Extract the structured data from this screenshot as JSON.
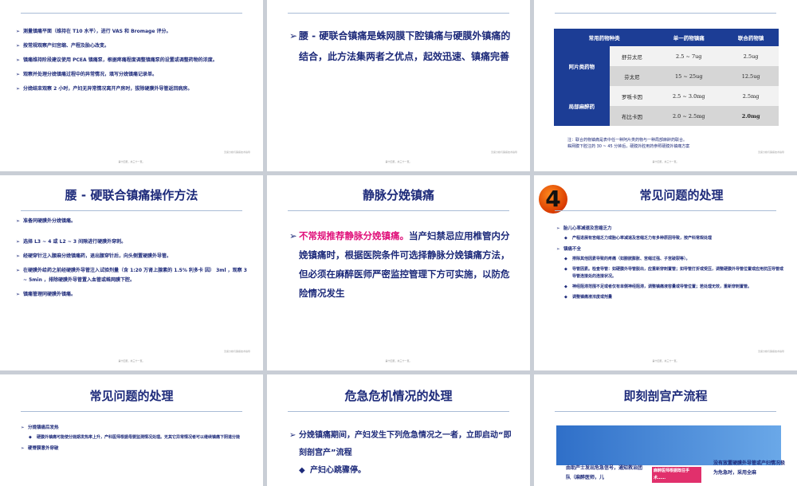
{
  "footer_text": "第十四页，共三十一页。",
  "footer_right": "无痛分娩与镇痛技术指导",
  "slide1": {
    "bullets": [
      "测量镇痛平面（维持在 T10 水平），进行 VAS 和 Bromage 评分。",
      "按常规观察产妇宫缩、产程及胎心改变。",
      "镇痛维持阶段建议使用 PCEA 镇痛泵，根据疼痛程度调整镇痛泵的设置或调整药物的浓度。",
      "观察并处理分娩镇痛过程中的异常情况，填写分娩镇痛记录单。",
      "分娩结束观察 2 小时，产妇无异常情况离开产房时，拔除硬膜外导管返回病房。"
    ]
  },
  "slide2": {
    "text": "腰 - 硬联合镇痛是蛛网膜下腔镇痛与硬膜外镇痛的结合，此方法集两者之优点，起效迅速、镇痛完善"
  },
  "slide3": {
    "headers": [
      "常用药物种类",
      "单一药物镇痛",
      "联合药物镇"
    ],
    "groups": [
      "阿片类药物",
      "局部麻醉药"
    ],
    "rows": [
      {
        "drug": "舒芬太尼",
        "single": "2.5 ~ 7ug",
        "combo": "2.5ug"
      },
      {
        "drug": "芬太尼",
        "single": "15 ~ 25ug",
        "combo": "12.5ug"
      },
      {
        "drug": "罗哌卡因",
        "single": "2.5 ~ 3.0mg",
        "combo": "2.5mg"
      },
      {
        "drug": "布比卡因",
        "single": "2.0 ~ 2.5mg",
        "combo": "2.0mg"
      }
    ],
    "note_lines": [
      "注：联合药物镇痛是表中任一种阿片类药物与一种局部麻醉药联合。",
      "蛛网膜下腔注药 30 ~ 45 分钟后，硬膜外腔用药参照硬膜外镇痛方案"
    ]
  },
  "slide4": {
    "title": "腰 - 硬联合镇痛操作方法",
    "bullets": [
      "准备同硬膜外分娩镇痛。",
      "选择 L3 ~ 4 或 L2 ~ 3 间隙进行硬膜外穿刺。",
      "经硬穿针注入腰麻分娩镇痛药，退出腰穿针后，向头侧置硬膜外导管。",
      "在硬膜外给药之前经硬膜外导管注入试验剂量（含 1:20 万肾上腺素的 1.5% 利多卡 因） 3ml ，观察 3 ~ 5min ，排除硬膜外导管置入血管或蛛网膜下腔。",
      "镇痛管理同硬膜外镇痛。"
    ]
  },
  "slide5": {
    "title": "静脉分娩镇痛",
    "highlight": "不常规推荐静脉分娩镇痛。",
    "text": "当产妇禁忌应用椎管内分娩镇痛时，根据医院条件可选择静脉分娩镇痛方法，但必须在麻醉医师严密监控管理下方可实施，以防危险情况发生"
  },
  "slide6": {
    "title": "常见问题的处理",
    "number": "4",
    "items": [
      {
        "text": "胎儿心率减速及宫缩乏力",
        "level": 1
      },
      {
        "text": "产程进展有宫缩乏力或胎心率减速及宫缩乏力有多种原因导致，按产科常规处理",
        "level": 2
      },
      {
        "text": "镇痛不全",
        "level": 1
      },
      {
        "text": "排除其他因素导致的疼痛（如膀胱膨胀、宫缩过强、子宫破裂等）。",
        "level": 2
      },
      {
        "text": "导管因素。检查导管：如硬膜外导管脱出，应重新穿刺置管；如导管打折或受压，调整硬膜外导管位置或应用抗压导管或导管连接处的连接状况。",
        "level": 2
      },
      {
        "text": "神经阻滞范围不足或者仅有单侧神经阻滞，调整镇痛液容量或导管位置；若处理无效，重新穿刺置管。",
        "level": 2
      },
      {
        "text": "调整镇痛液浓度或剂量",
        "level": 2
      }
    ]
  },
  "slide7": {
    "title": "常见问题的处理",
    "items": [
      {
        "text": "分娩镇痛后发热",
        "level": 1
      },
      {
        "text": "硬膜外镇痛可能使分娩期发热率上升，产科医师根据母婴监测情况处理。无其它异常情况者可以继续镇痛下阴道分娩",
        "level": 2
      },
      {
        "text": "硬脊膜意外穿破",
        "level": 1
      }
    ]
  },
  "slide8": {
    "title": "危急危机情况的处理",
    "text": "分娩镇痛期间，产妇发生下列危急情况之一者，立即启动“即刻剖宫产”流程",
    "sub": "产妇心跳骤停。"
  },
  "slide9": {
    "title": "即刻剖宫产流程",
    "flow_a": "由助产士发出危急信号，通知救治团队（麻醉医师，儿",
    "flow_b": "麻醉医师根据既往手术……",
    "flow_c": "没有放置硬膜外导管或产妇情况极为危急时，采用全麻"
  }
}
